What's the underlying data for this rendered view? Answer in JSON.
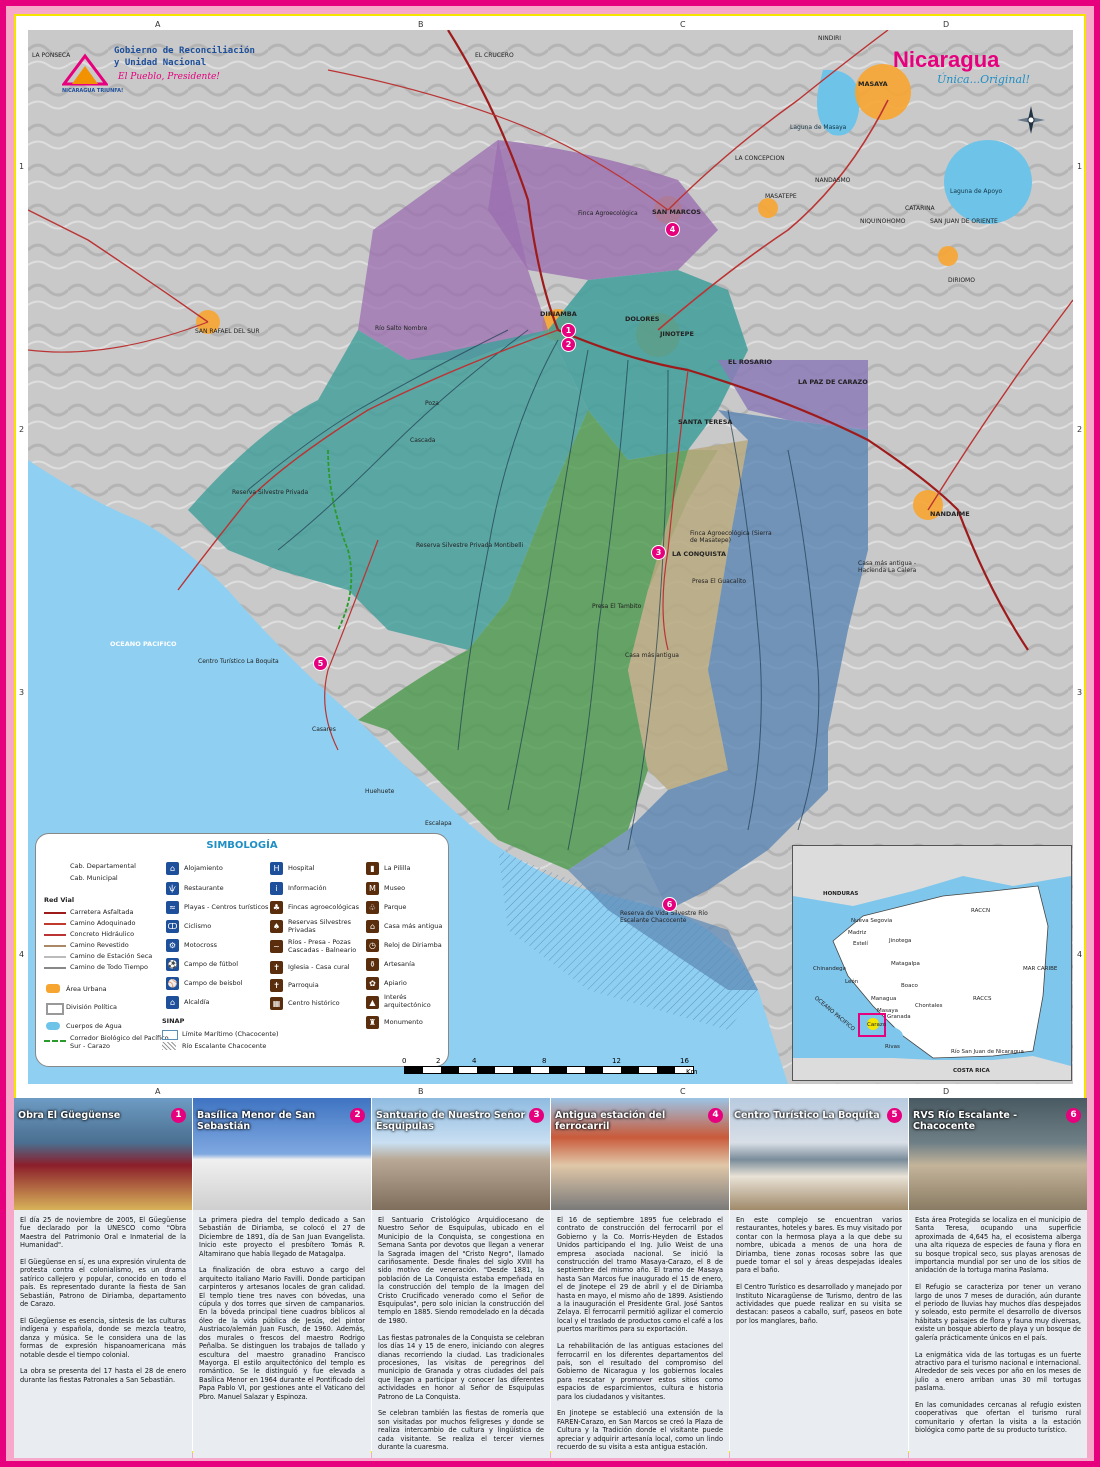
{
  "header": {
    "gov_line1": "Gobierno de Reconciliación",
    "gov_line2": "y Unidad Nacional",
    "gov_slogan": "El Pueblo, Presidente!",
    "gov_badge": "NICARAGUA TRIUNFA!",
    "brand": "Nicaragua",
    "brand_tagline": "Única...Original!"
  },
  "grid": {
    "cols": [
      "A",
      "B",
      "C",
      "D"
    ],
    "rows": [
      "1",
      "2",
      "3",
      "4"
    ]
  },
  "map_labels": {
    "towns": [
      "DIRIAMBA",
      "DOLORES",
      "JINOTEPE",
      "SAN MARCOS",
      "EL ROSARIO",
      "LA PAZ DE CARAZO",
      "SANTA TERESA",
      "LA CONQUISTA",
      "MASAYA",
      "NANDAIME",
      "CATARINA",
      "DIRIOMO",
      "MASATEPE",
      "NANDASMO",
      "LA CONCEPCION",
      "NIQUINOHOMO",
      "SAN JUAN DE ORIENTE",
      "SAN RAFAEL DEL SUR",
      "EL CRUCERO",
      "NINDIRI",
      "LA PONSECA"
    ],
    "features": [
      "OCEANO PACIFICO",
      "Laguna de Apoyo",
      "Laguna de Masaya",
      "Reserva Silvestre Privada",
      "Finca Agroecológica",
      "Cascada",
      "Poza",
      "Río Salto Nombre",
      "Centro Turístico La Boquita",
      "Casares",
      "Huehuete",
      "Escalapa",
      "Presa El Tambito",
      "Casa más antigua",
      "Reserva de Vida Silvestre Río Escalante Chacocente",
      "Casa más antigua - Hacienda La Calera",
      "Presa El Guacalito",
      "Finca Agroecológica (Sierra de Masatepe)",
      "Reserva Silvestre Privada Montibelli"
    ]
  },
  "legend": {
    "title": "SIMBOLOGÍA",
    "cab_departamental": "Cab. Departamental",
    "cab_municipal": "Cab. Municipal",
    "red_vial": "Red Vial",
    "roads": [
      "Carretera Asfaltada",
      "Camino Adoquinado",
      "Concreto Hidráulico",
      "Camino Revestido",
      "Camino de Estación Seca",
      "Camino de Todo Tiempo"
    ],
    "area_urbana": "Área Urbana",
    "division_politica": "División Política",
    "cuerpos_agua": "Cuerpos de Agua",
    "corredor": "Corredor Biológico del Pacífico Sur - Carazo",
    "col2": [
      "Alojamiento",
      "Restaurante",
      "Playas - Centros turísticos",
      "Ciclismo",
      "Motocross",
      "Campo de fútbol",
      "Campo de beisbol",
      "Alcaldía"
    ],
    "col3": [
      "Hospital",
      "Información",
      "Fincas agroecológicas",
      "Reservas Silvestres Privadas",
      "Ríos - Presa - Pozas Cascadas - Balneario",
      "Iglesia - Casa cural",
      "Parroquia",
      "Centro histórico"
    ],
    "col4": [
      "La Pililla",
      "Museo",
      "Parque",
      "Casa más antigua",
      "Reloj de Diriamba",
      "Artesanía",
      "Apiario",
      "Interés arquitectónico",
      "Monumento"
    ],
    "sinap": "SINAP",
    "limite": "Límite Marítimo (Chacocente)",
    "rio": "Río Escalante Chacocente",
    "scale_labels": [
      "0",
      "2",
      "4",
      "8",
      "12",
      "16"
    ],
    "scale_unit": "Km"
  },
  "inset": {
    "labels": [
      "HONDURAS",
      "RACCN",
      "RACCS",
      "MAR CARIBE",
      "OCEANO PACIFICO",
      "COSTA RICA",
      "Nueva Segovia",
      "Madriz",
      "Estelí",
      "Jinotega",
      "Chinandega",
      "León",
      "Matagalpa",
      "Boaco",
      "Chontales",
      "Managua",
      "Granada",
      "Rivas",
      "Río San Juan de Nicaragua",
      "Carazo",
      "Masaya"
    ]
  },
  "panels": [
    {
      "num": "1",
      "title": "Obra El Güegüense",
      "text": "El día 25 de noviembre de 2005, El Güegüense fue declarado por la UNESCO como \"Obra Maestra del Patrimonio Oral e Inmaterial de la Humanidad\".\n\nEl Güegüense en sí, es una expresión virulenta de protesta contra el colonialismo, es un drama satírico callejero y popular, conocido en todo el país. Es representado durante la fiesta de San Sebastián, Patrono de Diriamba, departamento de Carazo.\n\nEl Güegüense es esencia, síntesis de las culturas indígena y española, donde se mezcla teatro, danza y música. Se le considera una de las formas de expresión hispanoamericana más notable desde el tiempo colonial.\n\nLa obra se presenta del 17 hasta el 28 de enero durante las fiestas Patronales a San Sebastián."
    },
    {
      "num": "2",
      "title": "Basílica Menor de San Sebastián",
      "text": "La primera piedra del templo dedicado a San Sebastián de Diriamba, se colocó el 27 de Diciembre de 1891, día de San Juan Evangelista. Inicio este proyecto el presbítero Tomás R. Altamirano que había llegado de Matagalpa.\n\nLa finalización de obra estuvo a cargo del arquitecto italiano Mario Favilli. Donde participan carpinteros y artesanos locales de gran calidad. El templo tiene tres naves con bóvedas, una cúpula y dos torres que sirven de campanarios. En la bóveda principal tiene cuadros bíblicos al óleo de la vida pública de Jesús, del pintor Austriaco/alemán Juan Fusch, de 1960. Además, dos murales o frescos del maestro Rodrigo Peñalba. Se distinguen los trabajos de tallado y escultura del maestro granadino Francisco Mayorga. El estilo arquitectónico del templo es romántico. Se le distinguió y fue elevada a Basílica Menor en 1964 durante el Pontificado del Papa Pablo VI, por gestiones ante el Vaticano del Pbro. Manuel Salazar y Espinoza."
    },
    {
      "num": "3",
      "title": "Santuario de Nuestro Señor Esquipulas",
      "text": "El Santuario Cristológico Arquidiocesano de Nuestro Señor de Esquipulas, ubicado en el Municipio de la Conquista, se congestiona en Semana Santa por devotos que llegan a venerar la Sagrada imagen del \"Cristo Negro\", llamado cariñosamente. Desde finales del siglo XVIII ha sido motivo de veneración. \"Desde 1881, la población de La Conquista estaba empeñada en la construcción del templo de la Imagen del Cristo Crucificado venerado como el Señor de Esquipulas\", pero solo inician la construcción del templo en 1885. Siendo remodelado en la década de 1980.\n\nLas fiestas patronales de la Conquista se celebran los días 14 y 15 de enero, iniciando con alegres dianas recorriendo la ciudad. Las tradicionales procesiones, las visitas de peregrinos del municipio de Granada y otras ciudades del país que llegan a participar y conocer las diferentes actividades en honor al Señor de Esquipulas Patrono de La Conquista.\n\nSe celebran también las fiestas de romería que son visitadas por muchos feligreses y donde se realiza intercambio de cultura y lingüística de cada visitante. Se realiza el tercer viernes durante la cuaresma."
    },
    {
      "num": "4",
      "title": "Antigua estación del ferrocarril",
      "text": "El 16 de septiembre 1895 fue celebrado el contrato de construcción del ferrocarril por el Gobierno y la Co. Morris-Heyden de Estados Unidos participando el Ing. Julio Weist de una empresa asociada nacional. Se inició la construcción del tramo Masaya-Carazo, el 8 de septiembre del mismo año. El tramo de Masaya hasta San Marcos fue inaugurado el 15 de enero, el de Jinotepe el 29 de abril y el de Diriamba hasta en mayo, el mismo año de 1899. Asistiendo a la inauguración el Presidente Gral. José Santos Zelaya. El ferrocarril permitió agilizar el comercio local y el traslado de productos como el café a los puertos marítimos para su exportación.\n\nLa rehabilitación de las antiguas estaciones del ferrocarril en los diferentes departamentos del país, son el resultado del compromiso del Gobierno de Nicaragua y los gobiernos locales para rescatar y promover estos sitios como espacios de esparcimientos, cultura e historia para los ciudadanos y visitantes.\n\nEn Jinotepe se estableció una extensión de la FAREN-Carazo, en San Marcos se creó la Plaza de Cultura y la Tradición donde el visitante puede apreciar y adquirir artesanía local, como un lindo recuerdo de su visita a esta antigua estación."
    },
    {
      "num": "5",
      "title": "Centro Turístico La Boquita",
      "text": "En este complejo se encuentran varios restaurantes, hoteles y bares. Es muy visitado por contar con la hermosa playa a la que debe su nombre, ubicada a menos de una hora de Diriamba, tiene zonas rocosas sobre las que puede tomar el sol y áreas despejadas ideales para el baño.\n\nEl Centro Turístico es desarrollado y manejado por Instituto Nicaragüense de Turismo, dentro de las actividades que puede realizar en su visita se destacan: paseos a caballo, surf, paseos en bote por los manglares, baño."
    },
    {
      "num": "6",
      "title": "RVS Río Escalante - Chacocente",
      "text": "Esta área Protegida se localiza en el municipio de Santa Teresa, ocupando una superficie aproximada de 4,645 ha, el ecosistema alberga una alta riqueza de especies de fauna y flora en su bosque tropical seco, sus playas arenosas de importancia mundial por ser uno de los sitios de anidación de la tortuga marina Paslama.\n\nEl Refugio se caracteriza por tener un verano largo de unos 7 meses de duración, aún durante el periodo de lluvias hay muchos días despejados y soleado, esto permite el desarrollo de diversos hábitats y paisajes de flora y fauna muy diversas, existe un bosque abierto de playa y un bosque de galería prácticamente únicos en el país.\n\nLa enigmática vida de las tortugas es un fuerte atractivo para el turismo nacional e internacional. Alrededor de seis veces por año en los meses de julio a enero arriban unas 30 mil tortugas paslama.\n\nEn las comunidades cercanas al refugio existen cooperativas que ofertan el turismo rural comunitario y ofertan la visita a la estación biológica como parte de su producto turístico."
    }
  ],
  "colors": {
    "frame": "#e6007e",
    "purple_zone": "#9b6fb0",
    "teal_zone": "#3f9e9a",
    "green_zone": "#4b9a4c",
    "blue_zone": "#5b86b4",
    "tan_zone": "#b9a97f",
    "urban": "#f7a531",
    "ocean": "#8fd0f2"
  }
}
